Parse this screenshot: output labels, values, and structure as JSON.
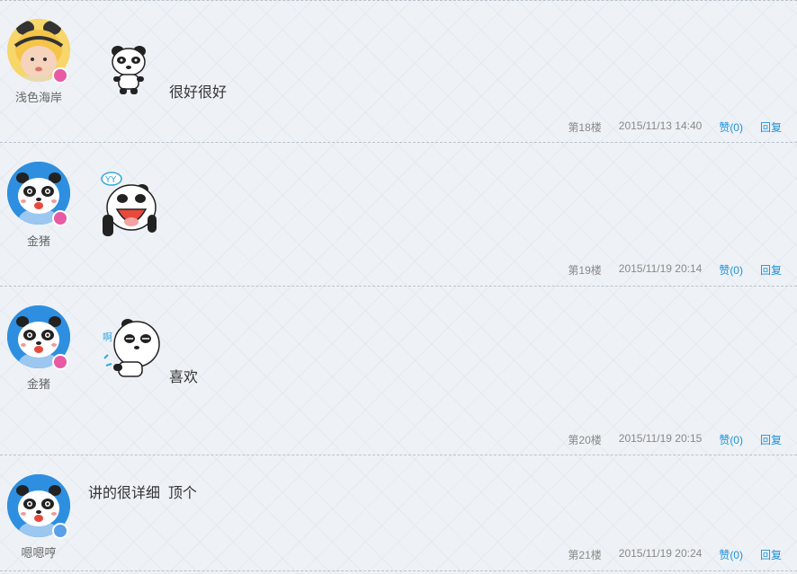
{
  "posts": [
    {
      "username": "浅色海岸",
      "text": "很好很好",
      "floor": "第18楼",
      "time": "2015/11/13 14:40",
      "like": "赞(0)",
      "reply": "回复",
      "badge_color": "#e85aa3"
    },
    {
      "username": "金猪",
      "text": "",
      "floor": "第19楼",
      "time": "2015/11/19 20:14",
      "like": "赞(0)",
      "reply": "回复",
      "badge_color": "#e85aa3"
    },
    {
      "username": "金猪",
      "text": "喜欢",
      "floor": "第20楼",
      "time": "2015/11/19 20:15",
      "like": "赞(0)",
      "reply": "回复",
      "badge_color": "#e85aa3"
    },
    {
      "username": "嗯嗯哼",
      "text": "讲的很详细  顶个",
      "floor": "第21楼",
      "time": "2015/11/19 20:24",
      "like": "赞(0)",
      "reply": "回复",
      "badge_color": "#5aa0e8"
    }
  ],
  "colors": {
    "link": "#1e90d9",
    "meta": "#888888"
  }
}
